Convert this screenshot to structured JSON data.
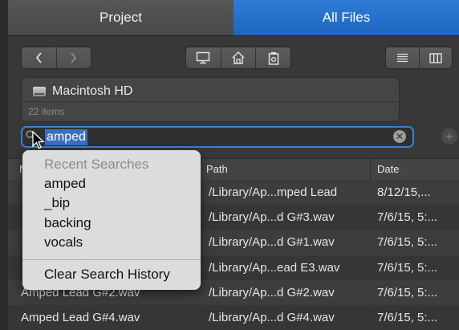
{
  "tabs": [
    {
      "label": "Project",
      "active": false
    },
    {
      "label": "All Files",
      "active": true
    }
  ],
  "toolbar": {
    "back_icon": "chevron-left-icon",
    "forward_icon": "chevron-right-icon",
    "computer_icon": "computer-icon",
    "home_icon": "home-icon",
    "project_icon": "project-folder-icon",
    "list_view_icon": "list-view-icon",
    "column_view_icon": "column-view-icon"
  },
  "location": {
    "name": "Macintosh HD",
    "item_count": "22 items"
  },
  "search": {
    "value": "amped",
    "icon": "search-icon",
    "clear_icon": "clear-icon"
  },
  "add_icon": "plus-icon",
  "recent_searches": {
    "header": "Recent Searches",
    "items": [
      "amped",
      "_bip",
      "backing",
      "vocals"
    ],
    "clear_label": "Clear Search History"
  },
  "table": {
    "columns": [
      "Name",
      "Path",
      "Date"
    ],
    "rows": [
      {
        "name": "",
        "path": "/Library/Ap...mped Lead",
        "date": "8/12/15,..."
      },
      {
        "name": "",
        "path": "/Library/Ap...d G#3.wav",
        "date": "7/6/15, 5:..."
      },
      {
        "name": "",
        "path": "/Library/Ap...d G#1.wav",
        "date": "7/6/15, 5:..."
      },
      {
        "name": "",
        "path": "/Library/Ap...ead E3.wav",
        "date": "7/6/15, 5:..."
      },
      {
        "name": "Amped Lead G#2.wav",
        "path": "/Library/Ap...d G#2.wav",
        "date": "7/6/15, 5:..."
      },
      {
        "name": "Amped Lead G#4.wav",
        "path": "/Library/Ap...d G#4.wav",
        "date": "7/6/15, 5:..."
      }
    ]
  },
  "colors": {
    "accent": "#1d66c0",
    "search_border": "#3f7fd2",
    "selection": "#3b6fc4"
  }
}
